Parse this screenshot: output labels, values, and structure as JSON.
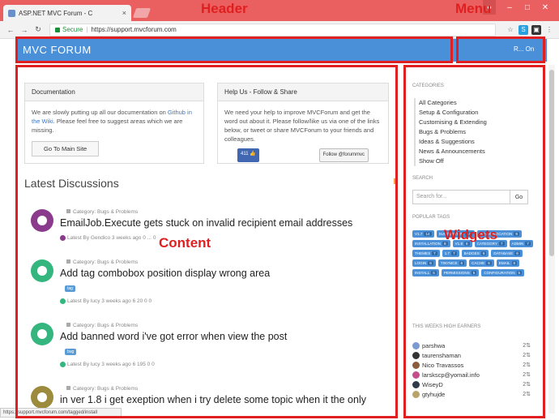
{
  "browser": {
    "tab_title": "ASP.NET MVC Forum - C",
    "tab_close": "×",
    "secure_label": "Secure",
    "url": "https://support.mvcforum.com"
  },
  "site": {
    "logo": "MVC FORUM",
    "menu_link": "R... On"
  },
  "annotations": {
    "header": "Header",
    "menu": "Menu",
    "content": "Content",
    "widgets": "Widgets"
  },
  "panels": {
    "documentation": {
      "title": "Documentation",
      "text_before": "We are slowly putting up all our documentation on ",
      "link": "Github in the Wiki",
      "text_after": ". Please feel free to suggest areas which we are missing.",
      "button": "Go To Main Site"
    },
    "help": {
      "title": "Help Us - Follow & Share",
      "text": "We need your help to improve MVCForum and get the word out about it. Please follow/like us via one of the links below, or tweet or share MVCForum to your friends and colleagues.",
      "facebook": "411 👍",
      "twitter": "Follow @forummvc"
    }
  },
  "latest": {
    "heading": "Latest Discussions",
    "topics": [
      {
        "category": "Category: Bugs & Problems",
        "title": "EmailJob.Execute gets stuck on invalid recipient email addresses",
        "tag": "",
        "meta": "Latest By Gendico 3 weeks ago  0  ...  0"
      },
      {
        "category": "Category: Bugs & Problems",
        "title": "Add tag combobox position display wrong area",
        "tag": "tag",
        "meta": "Latest By lucy 3 weeks ago  6  20  0  0"
      },
      {
        "category": "Category: Bugs & Problems",
        "title": "Add banned word i've got error when view the post",
        "tag": "bug",
        "meta": "Latest By lucy 3 weeks ago  6  195  0  0"
      },
      {
        "category": "Category: Bugs & Problems",
        "title": "in ver 1.8 i get exeption when i try delete some topic when it the only",
        "tag": "",
        "meta": ""
      }
    ]
  },
  "widgets": {
    "categories_title": "CATEGORIES",
    "categories": [
      "All Categories",
      "Setup & Configuration",
      "Customising & Extending",
      "Bugs & Problems",
      "Ideas & Suggestions",
      "News & Announcements",
      "Show Off"
    ],
    "search_title": "SEARCH",
    "search_placeholder": "Search for...",
    "search_button": "Go",
    "tags_title": "POPULAR TAGS",
    "tags": [
      {
        "name": "V1.7",
        "count": "14"
      },
      {
        "name": "SUGGESTION",
        "count": "10"
      },
      {
        "name": "AUTHENTICATION",
        "count": "9"
      },
      {
        "name": "INSTALLATION",
        "count": "8"
      },
      {
        "name": "V1.8",
        "count": "8"
      },
      {
        "name": "CATEGORY",
        "count": "7"
      },
      {
        "name": "ADMIN",
        "count": "7"
      },
      {
        "name": "THEMES",
        "count": "7"
      },
      {
        "name": "1.7",
        "count": "7"
      },
      {
        "name": "BADGES",
        "count": "6"
      },
      {
        "name": "DATABASE",
        "count": "6"
      },
      {
        "name": "LOGIN",
        "count": "6"
      },
      {
        "name": "TINYMCE",
        "count": "6"
      },
      {
        "name": "CACHE",
        "count": "6"
      },
      {
        "name": "EMAIL",
        "count": "6"
      },
      {
        "name": "INSTALL",
        "count": "5"
      },
      {
        "name": "PERMISSIONS",
        "count": "5"
      },
      {
        "name": "CONFIGURATION",
        "count": "5"
      }
    ],
    "earners_title": "THIS WEEKS HIGH EARNERS",
    "earners": [
      {
        "name": "parshwa",
        "points": "2",
        "color": "#7a9bd1"
      },
      {
        "name": "taurenshaman",
        "points": "2",
        "color": "#333333"
      },
      {
        "name": "Nico Travassos",
        "points": "2",
        "color": "#8c5a3c"
      },
      {
        "name": "larskscp@yomail.info",
        "points": "2",
        "color": "#c44d8a"
      },
      {
        "name": "WiseyD",
        "points": "2",
        "color": "#2f3a4a"
      },
      {
        "name": "gtyhujde",
        "points": "2",
        "color": "#b9a36a"
      }
    ]
  },
  "statusbar": "https://support.mvcforum.com/tagged/install"
}
